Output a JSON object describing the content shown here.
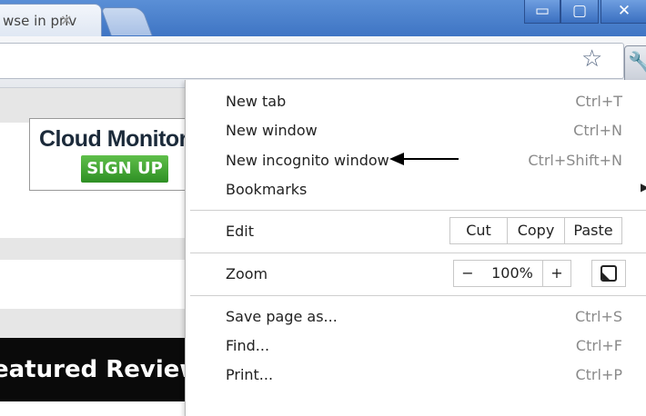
{
  "tab": {
    "title": "wse in priv",
    "close_icon": "close-icon"
  },
  "window_controls": {
    "minimize": "▭",
    "maximize": "▢",
    "close": "✕"
  },
  "toolbar": {
    "star_icon": "☆",
    "wrench_icon": "🔧"
  },
  "page": {
    "ad_title": "Cloud Monitorin",
    "ad_button": "SIGN UP",
    "featured": "eatured Review"
  },
  "menu": {
    "new_tab": {
      "label": "New tab",
      "shortcut": "Ctrl+T"
    },
    "new_window": {
      "label": "New window",
      "shortcut": "Ctrl+N"
    },
    "new_incognito": {
      "label": "New incognito window",
      "shortcut": "Ctrl+Shift+N"
    },
    "bookmarks": {
      "label": "Bookmarks",
      "arrow": "▶"
    },
    "edit": {
      "label": "Edit",
      "cut": "Cut",
      "copy": "Copy",
      "paste": "Paste"
    },
    "zoom": {
      "label": "Zoom",
      "minus": "−",
      "value": "100%",
      "plus": "+"
    },
    "save_page": {
      "label": "Save page as...",
      "shortcut": "Ctrl+S"
    },
    "find": {
      "label": "Find...",
      "shortcut": "Ctrl+F"
    },
    "print": {
      "label": "Print...",
      "shortcut": "Ctrl+P"
    }
  }
}
